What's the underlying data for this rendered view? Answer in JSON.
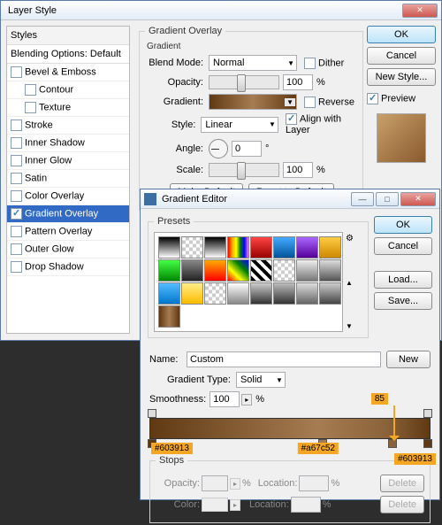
{
  "layerStyle": {
    "title": "Layer Style",
    "stylesHeading": "Styles",
    "blendingOptions": "Blending Options: Default",
    "items": [
      {
        "label": "Bevel & Emboss",
        "checked": false,
        "indent": 0
      },
      {
        "label": "Contour",
        "checked": false,
        "indent": 1
      },
      {
        "label": "Texture",
        "checked": false,
        "indent": 1
      },
      {
        "label": "Stroke",
        "checked": false,
        "indent": 0
      },
      {
        "label": "Inner Shadow",
        "checked": false,
        "indent": 0
      },
      {
        "label": "Inner Glow",
        "checked": false,
        "indent": 0
      },
      {
        "label": "Satin",
        "checked": false,
        "indent": 0
      },
      {
        "label": "Color Overlay",
        "checked": false,
        "indent": 0
      },
      {
        "label": "Gradient Overlay",
        "checked": true,
        "indent": 0,
        "selected": true
      },
      {
        "label": "Pattern Overlay",
        "checked": false,
        "indent": 0
      },
      {
        "label": "Outer Glow",
        "checked": false,
        "indent": 0
      },
      {
        "label": "Drop Shadow",
        "checked": false,
        "indent": 0
      }
    ],
    "panel": {
      "title": "Gradient Overlay",
      "sub": "Gradient",
      "blendMode": {
        "label": "Blend Mode:",
        "value": "Normal",
        "dither": "Dither"
      },
      "opacity": {
        "label": "Opacity:",
        "value": "100",
        "unit": "%"
      },
      "gradient": {
        "label": "Gradient:",
        "reverse": "Reverse"
      },
      "style": {
        "label": "Style:",
        "value": "Linear",
        "align": "Align with Layer"
      },
      "angle": {
        "label": "Angle:",
        "value": "0",
        "unit": "°"
      },
      "scale": {
        "label": "Scale:",
        "value": "100",
        "unit": "%"
      },
      "makeDefault": "Make Default",
      "resetDefault": "Reset to Default"
    },
    "ok": "OK",
    "cancel": "Cancel",
    "newStyle": "New Style...",
    "preview": "Preview"
  },
  "editor": {
    "title": "Gradient Editor",
    "presets": "Presets",
    "name": {
      "label": "Name:",
      "value": "Custom"
    },
    "new": "New",
    "type": {
      "label": "Gradient Type:",
      "value": "Solid"
    },
    "smoothness": {
      "label": "Smoothness:",
      "value": "100",
      "unit": "%"
    },
    "stops": {
      "title": "Stops",
      "opacity": "Opacity:",
      "location": "Location:",
      "color": "Color:",
      "delete": "Delete",
      "unit": "%"
    },
    "ok": "OK",
    "cancel": "Cancel",
    "load": "Load...",
    "save": "Save...",
    "tags": {
      "pos": "85",
      "c1": "#603913",
      "c2": "#a67c52",
      "c3": "#603913"
    }
  }
}
